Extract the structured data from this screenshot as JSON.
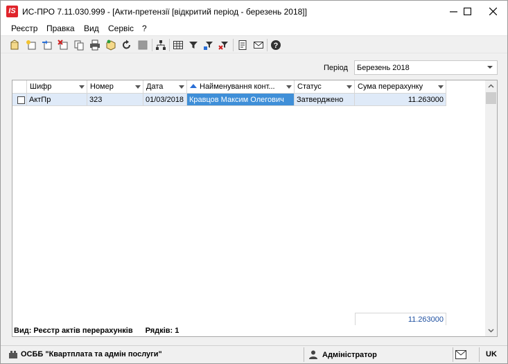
{
  "window": {
    "app_logo": "IS",
    "title": "ИС-ПРО 7.11.030.999 - [Акти-претензії [відкритий період - березень 2018]]"
  },
  "menu": {
    "items": [
      "Реєстр",
      "Правка",
      "Вид",
      "Сервіс",
      "?"
    ]
  },
  "toolbar": {
    "icons": [
      "new-document-icon",
      "new-copy-icon",
      "import-icon",
      "delete-icon",
      "copy-icon",
      "print-icon",
      "package-icon",
      "refresh-icon",
      "save-disabled-icon",
      "tree-icon",
      "table-icon",
      "filter-icon",
      "filter-settings-icon",
      "filter-clear-icon",
      "document-icon",
      "mail-icon",
      "help-icon"
    ]
  },
  "period": {
    "label": "Період",
    "value": "Березень 2018"
  },
  "grid": {
    "columns": [
      "Шифр",
      "Номер",
      "Дата",
      "Найменування конт...",
      "Статус",
      "Сума перерахунку"
    ],
    "rows": [
      {
        "checked": false,
        "code": "АктПр",
        "number": "323",
        "date": "01/03/2018",
        "counterparty": "Кравцов Максим Олегович",
        "status": "Затверджено",
        "amount": "11.263000"
      }
    ],
    "total_amount": "11.263000",
    "view_label": "Вид: Реєстр актів перерахунків",
    "rows_label": "Рядків: 1"
  },
  "statusbar": {
    "organization": "ОСББ \"Квартплата та адмін послуги\"",
    "user": "Адміністратор",
    "language": "UK"
  },
  "colors": {
    "selected_row": "#dfeaf8",
    "focused_cell": "#3f8fd8",
    "sort_arrow": "#2a6fd6",
    "logo": "#e0242b"
  }
}
